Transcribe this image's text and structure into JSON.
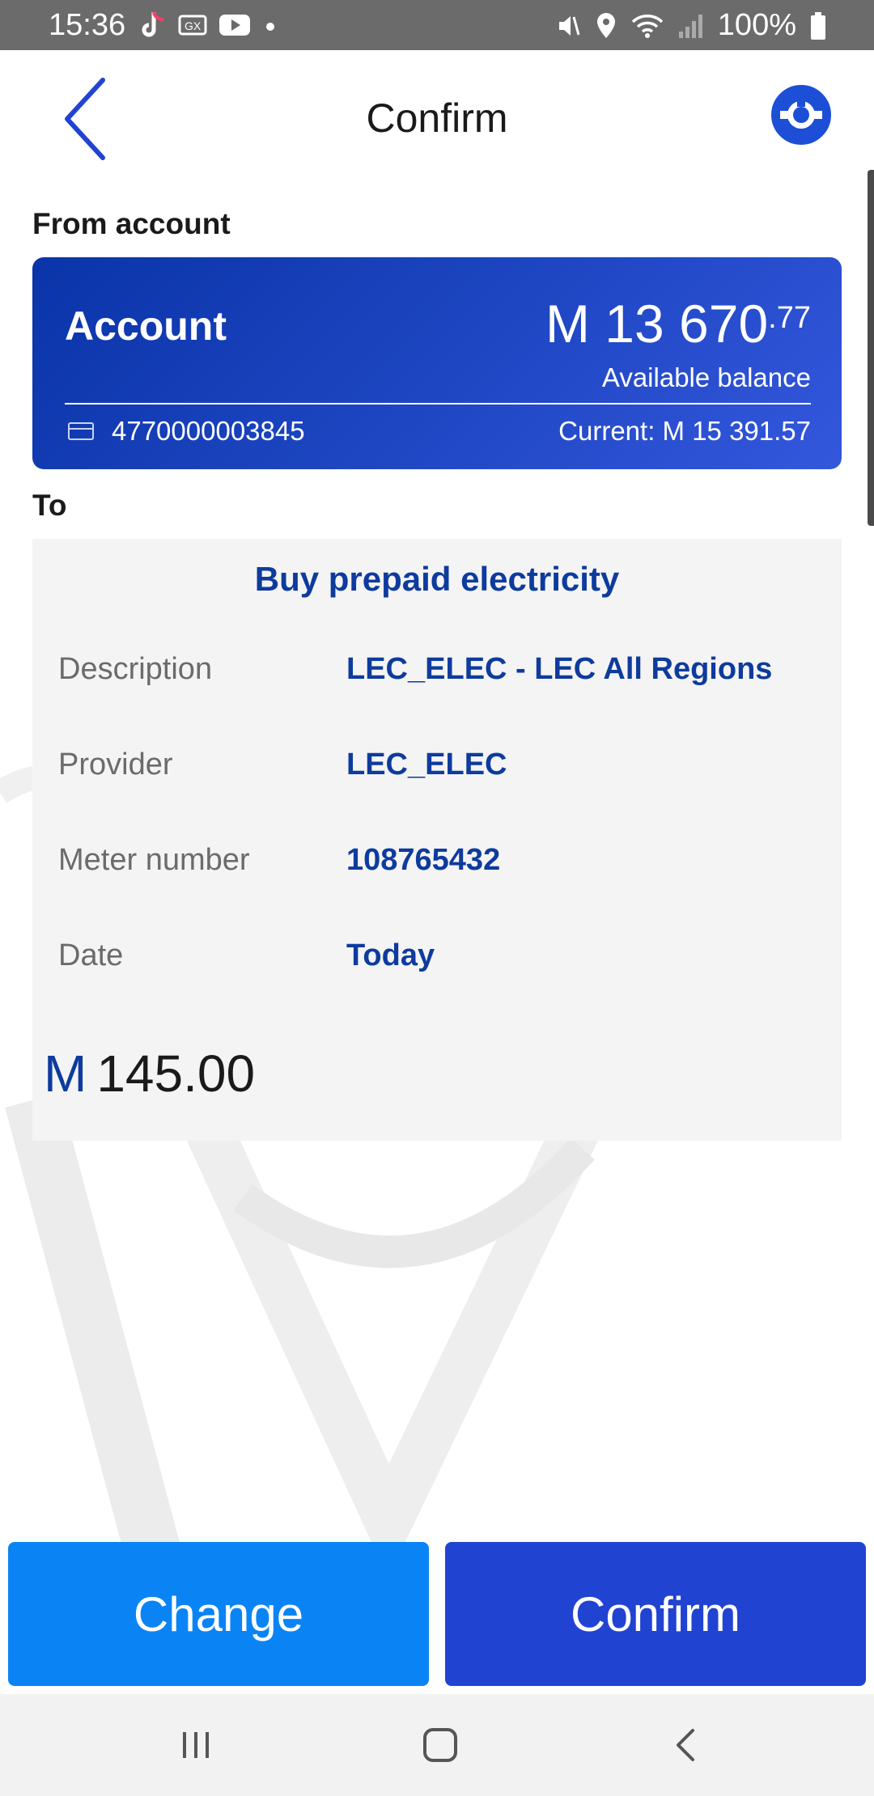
{
  "status_bar": {
    "time": "15:36",
    "battery": "100%",
    "left_icons": [
      "tiktok-icon",
      "message-icon",
      "youtube-icon",
      "dot-icon"
    ],
    "right_icons": [
      "mute-icon",
      "location-icon",
      "wifi-icon",
      "signal-icon",
      "battery-icon"
    ]
  },
  "header": {
    "title": "Confirm",
    "back_icon": "chevron-left-icon",
    "help_icon": "lifebuoy-icon"
  },
  "from_section": {
    "label": "From account",
    "account": {
      "name": "Account",
      "balance_main": "M 13 670",
      "balance_cents": ".77",
      "balance_caption": "Available balance",
      "number": "4770000003845",
      "current": "Current: M 15 391.57",
      "card_icon": "card-icon"
    }
  },
  "to_section": {
    "label": "To",
    "title": "Buy prepaid electricity",
    "rows": [
      {
        "label": "Description",
        "value": "LEC_ELEC - LEC All Regions"
      },
      {
        "label": "Provider",
        "value": "LEC_ELEC"
      },
      {
        "label": "Meter number",
        "value": "108765432"
      },
      {
        "label": "Date",
        "value": "Today"
      }
    ],
    "amount_currency": "M",
    "amount_value": "145.00"
  },
  "actions": {
    "change_label": "Change",
    "confirm_label": "Confirm"
  },
  "nav_bar": {
    "icons": [
      "recent-apps-icon",
      "home-icon",
      "back-icon"
    ]
  },
  "colors": {
    "primary_blue": "#0d3b9e",
    "card_gradient_start": "#0a34a8",
    "card_gradient_end": "#3457dc",
    "change_button": "#0a84f5",
    "confirm_button": "#2143d2"
  }
}
